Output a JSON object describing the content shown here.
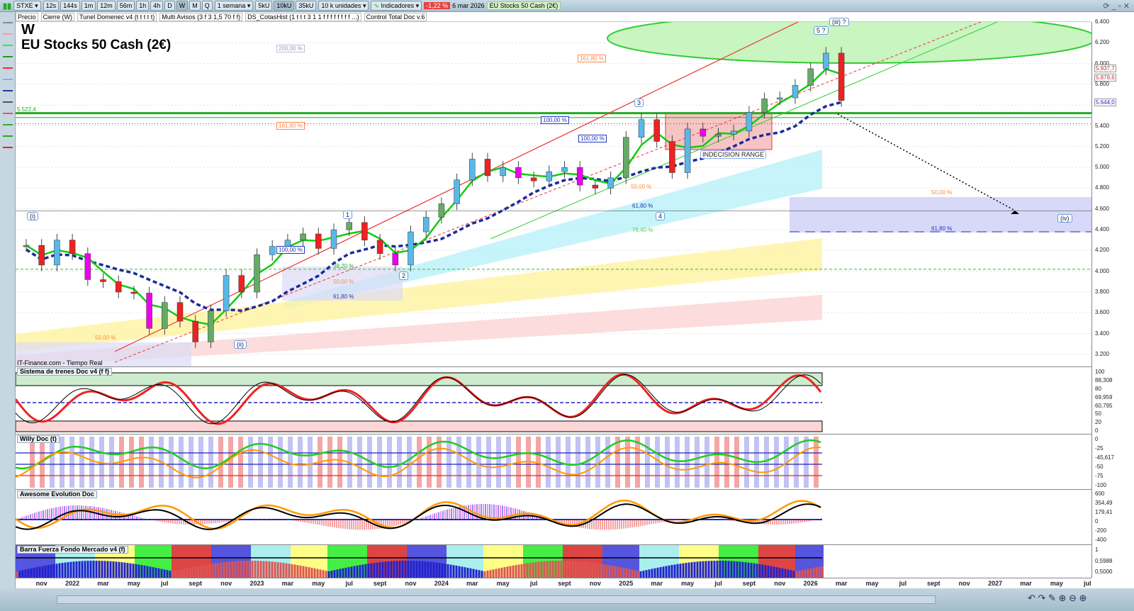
{
  "toolbar": {
    "symbol": "STXE",
    "timeframes": [
      "12s",
      "144s",
      "1m",
      "12m",
      "56m",
      "1h",
      "4h",
      "D",
      "W",
      "M",
      "Q"
    ],
    "active_timeframe": "W",
    "period": "1 semana",
    "units": [
      "5kU",
      "10kU",
      "35kU"
    ],
    "active_unit": "10kU",
    "units_select": "10 k unidades",
    "indicators_label": "Indicadores",
    "change": "-1,22 %",
    "date": "6 mar 2026",
    "instrument": "EU Stocks 50 Cash (2€)"
  },
  "indicator_bar": [
    "Precio",
    "Cierre (W)",
    "Tunel Domenec v4 (t t t t t)",
    "Multi Avisos (3 f 3 1,5 70 f f)",
    "DS_CotasHist (1 t t t 3 1 1 f f f f f f f f ...)",
    "Control Total Doc v.6"
  ],
  "chart": {
    "period_label": "W",
    "title": "EU Stocks 50 Cash (2€)",
    "source": "IT-Finance.com - Tiempo Real",
    "level_label": "5.522,4",
    "annotations": {
      "fib200": "200,00 %",
      "fib1618a": "161,80 %",
      "fib1618b": "161,80 %",
      "fib100a": "100,00 %",
      "fib100b": "100,00 %",
      "fib100c": "100,00 %",
      "fib50a": "50,00 %",
      "fib50b": "50,00 %",
      "fib50c": "50,00 %",
      "fib50d": "50,00 %",
      "fib618a": "61,80 %",
      "fib618b": "61,80 %",
      "fib618c": "61,80 %",
      "fib382": "38,20 %",
      "fib764": "76,40 %",
      "range": "INDECISION RANGE"
    },
    "waves": {
      "i": "(i)",
      "ii": "(ii)",
      "iii": "(iii) ?",
      "iv": "(iv)",
      "w1": "1",
      "w2": "2",
      "w3": "3",
      "w4": "4",
      "w5": "5 ?"
    }
  },
  "chart_data": {
    "type": "line",
    "title": "EU Stocks 50 Cash (2€)",
    "x": [
      "2021-10",
      "2021-11",
      "2021-12",
      "2022-01",
      "2022-02",
      "2022-03",
      "2022-04",
      "2022-05",
      "2022-06",
      "2022-07",
      "2022-08",
      "2022-09",
      "2022-10",
      "2022-11",
      "2022-12",
      "2023-01",
      "2023-02",
      "2023-03",
      "2023-04",
      "2023-05",
      "2023-06",
      "2023-07",
      "2023-08",
      "2023-09",
      "2023-10",
      "2023-11",
      "2023-12",
      "2024-01",
      "2024-02",
      "2024-03",
      "2024-04",
      "2024-05",
      "2024-06",
      "2024-07",
      "2024-08",
      "2024-09",
      "2024-10",
      "2024-11",
      "2024-12",
      "2025-01",
      "2025-02",
      "2025-03",
      "2025-04",
      "2025-05",
      "2025-06",
      "2025-07",
      "2025-08",
      "2025-09",
      "2025-10",
      "2025-11",
      "2025-12",
      "2026-01",
      "2026-02",
      "2026-03"
    ],
    "values": [
      4250,
      4060,
      4300,
      4170,
      3920,
      3900,
      3800,
      3790,
      3450,
      3700,
      3520,
      3320,
      3620,
      3960,
      3800,
      4160,
      4240,
      4300,
      4360,
      4220,
      4400,
      4470,
      4300,
      4170,
      4060,
      4380,
      4520,
      4650,
      4880,
      5080,
      4920,
      5000,
      4900,
      4870,
      4960,
      5000,
      4830,
      4800,
      4900,
      5290,
      5460,
      5250,
      4950,
      5370,
      5300,
      5320,
      5350,
      5530,
      5660,
      5670,
      5790,
      5950,
      6100,
      5644
    ],
    "ylim": [
      3200,
      6400
    ],
    "yticks": [
      "6.400",
      "6.200",
      "6.000",
      "5.800",
      "5.600",
      "5.400",
      "5.200",
      "5.000",
      "4.800",
      "4.600",
      "4.400",
      "4.200",
      "4.000",
      "3.800",
      "3.600",
      "3.400",
      "3.200"
    ],
    "xticks": [
      "nov",
      "2022",
      "mar",
      "may",
      "jul",
      "sept",
      "nov",
      "2023",
      "mar",
      "may",
      "jul",
      "sept",
      "nov",
      "2024",
      "mar",
      "may",
      "jul",
      "sept",
      "nov",
      "2025",
      "mar",
      "may",
      "jul",
      "sept",
      "nov",
      "2026",
      "mar",
      "may",
      "jul",
      "sept",
      "nov",
      "2027",
      "mar",
      "may",
      "jul"
    ],
    "price_tags": [
      "5.937,7",
      "5.879,6",
      "5.644,0"
    ]
  },
  "panels": [
    {
      "title": "Sistema de trenes Doc v4 (f f)",
      "ticks": [
        "100",
        "88,308",
        "80",
        "69,959",
        "60,795",
        "50",
        "20",
        "0"
      ]
    },
    {
      "title": "Willy Doc (t)",
      "ticks": [
        "0",
        "-25",
        "-45,617",
        "-50",
        "-75",
        "-100"
      ]
    },
    {
      "title": "Awesome Evolution Doc",
      "ticks": [
        "600",
        "354,49",
        "179,41",
        "0",
        "-200",
        "-400"
      ]
    },
    {
      "title": "Barra Fuerza Fondo Mercado v4 (f)",
      "ticks": [
        "1",
        "0,5988",
        "0,5000"
      ]
    }
  ],
  "colors": {
    "up": "#2e7d32",
    "down": "#e53935",
    "accent": "#1e4fbf",
    "ellipse": "#c8f5c0"
  }
}
